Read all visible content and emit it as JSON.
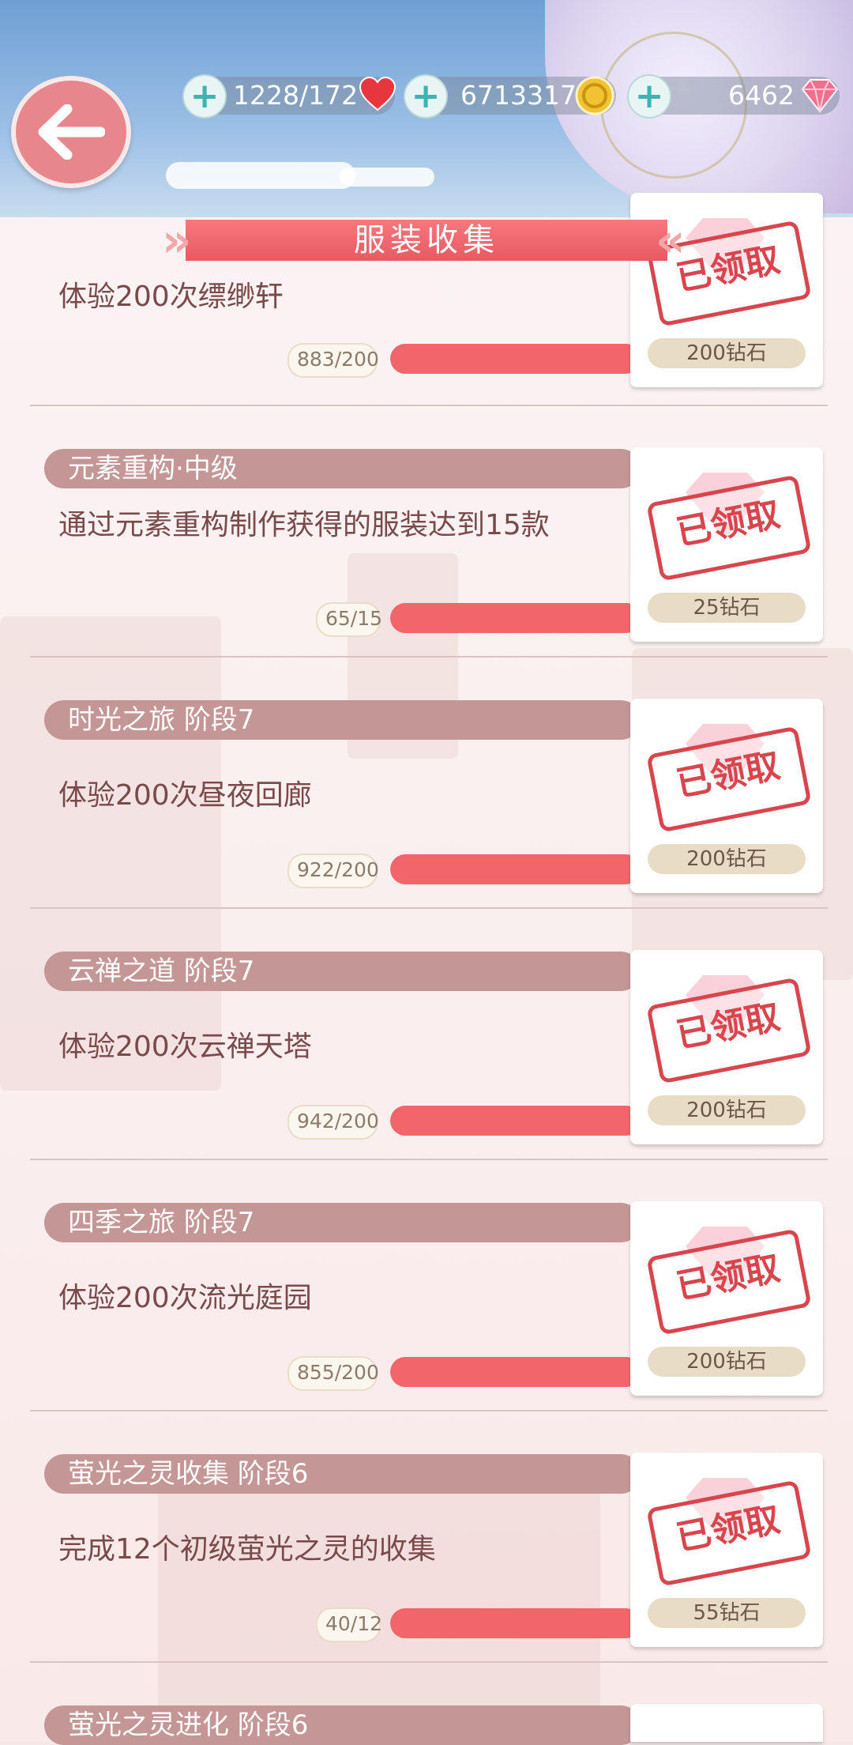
{
  "header": {
    "title": "服装收集",
    "stamina": "1228/172",
    "coins": "6713317",
    "diamonds": "6462"
  },
  "tasks": [
    {
      "category": "",
      "description": "体验200次缥缈轩",
      "count": "883/200",
      "progress": 1.0,
      "reward": "200钻石",
      "stamp": "已领取"
    },
    {
      "category": "元素重构·中级",
      "description": "通过元素重构制作获得的服装达到15款",
      "count": "65/15",
      "progress": 1.0,
      "reward": "25钻石",
      "stamp": "已领取"
    },
    {
      "category": "时光之旅 阶段7",
      "description": "体验200次昼夜回廊",
      "count": "922/200",
      "progress": 1.0,
      "reward": "200钻石",
      "stamp": "已领取"
    },
    {
      "category": "云禅之道 阶段7",
      "description": "体验200次云禅天塔",
      "count": "942/200",
      "progress": 1.0,
      "reward": "200钻石",
      "stamp": "已领取"
    },
    {
      "category": "四季之旅 阶段7",
      "description": "体验200次流光庭园",
      "count": "855/200",
      "progress": 1.0,
      "reward": "200钻石",
      "stamp": "已领取"
    },
    {
      "category": "萤光之灵收集 阶段6",
      "description": "完成12个初级萤光之灵的收集",
      "count": "40/12",
      "progress": 1.0,
      "reward": "55钻石",
      "stamp": "已领取"
    },
    {
      "category": "萤光之灵进化 阶段6",
      "description": "",
      "count": "",
      "progress": 0,
      "reward": "",
      "stamp": ""
    }
  ],
  "icons": {
    "back": "arrow-left-icon",
    "add": "plus-icon",
    "stamina": "heart-icon",
    "coin": "gold-coin-icon",
    "diamond": "diamond-icon"
  }
}
